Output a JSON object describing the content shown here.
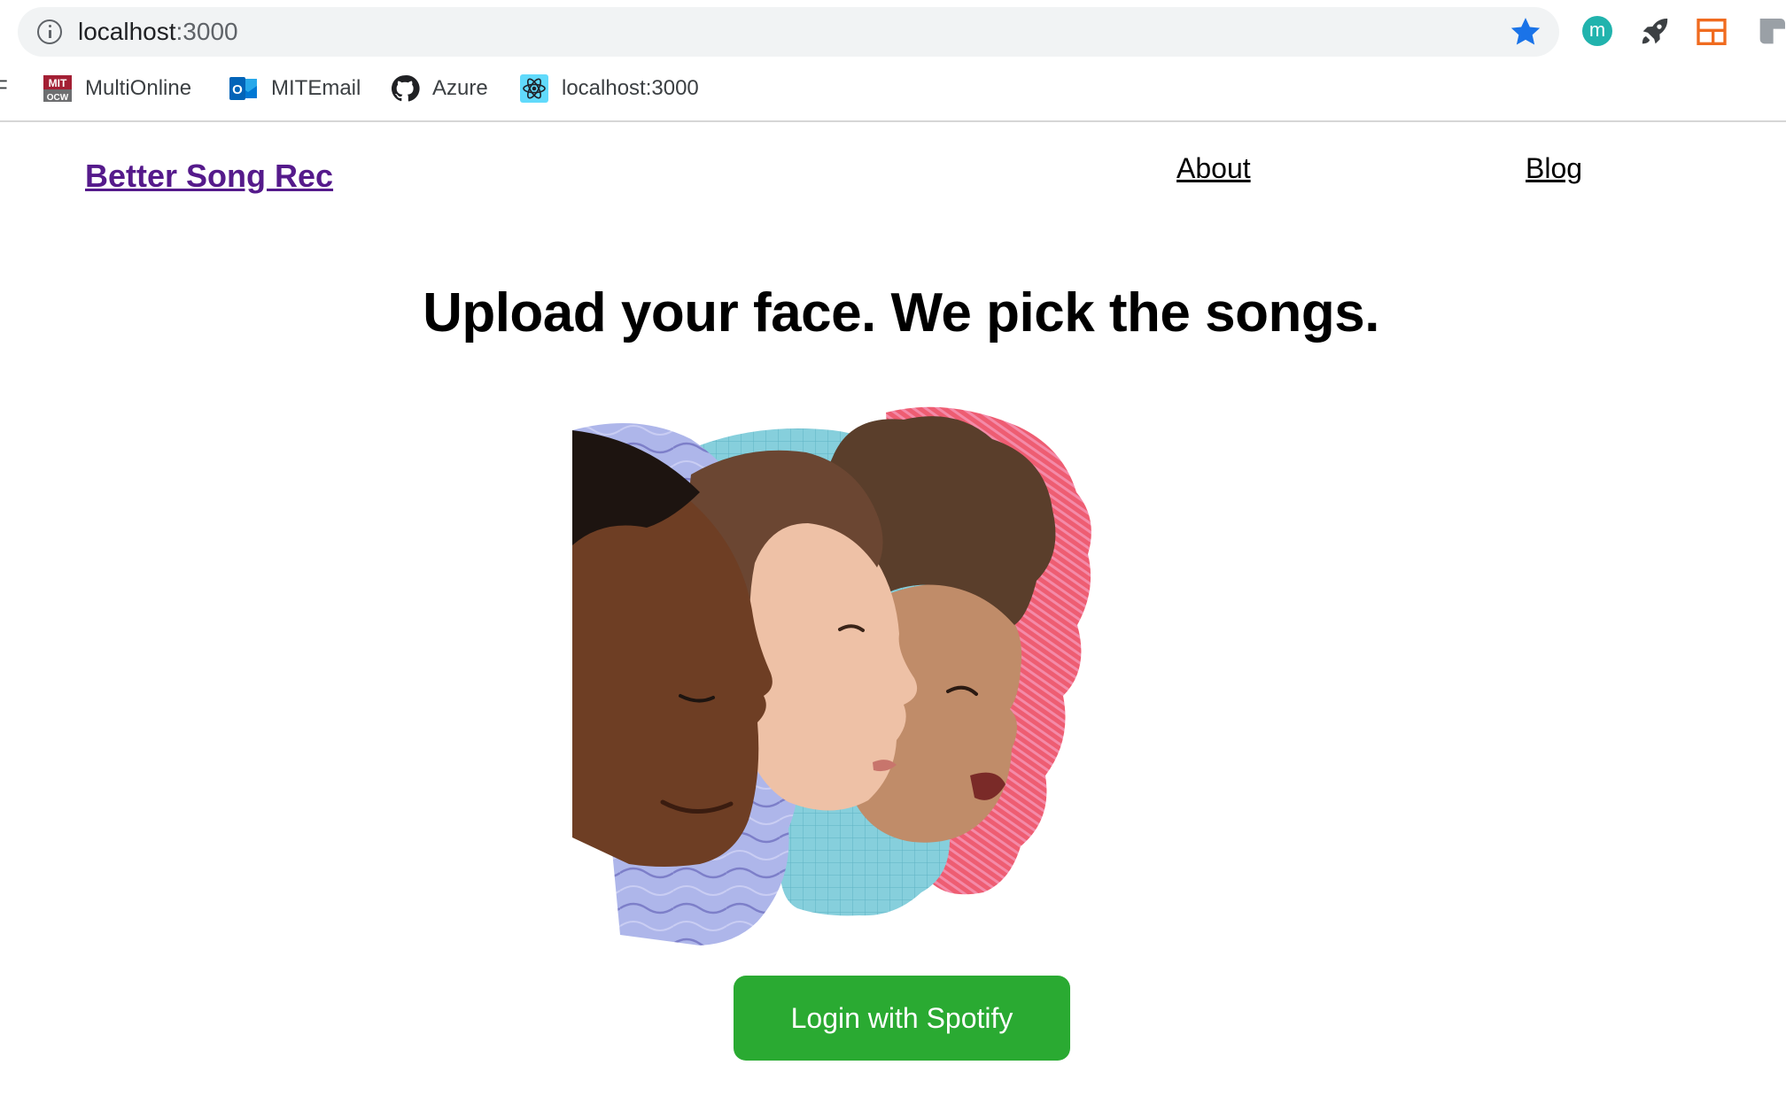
{
  "browser": {
    "url_host": "localhost",
    "url_port": ":3000",
    "extensions": {
      "m_label": "m"
    },
    "bookmarks": [
      {
        "label": "F"
      },
      {
        "label": "MultiOnline"
      },
      {
        "label": "MITEmail"
      },
      {
        "label": "Azure"
      },
      {
        "label": "localhost:3000"
      }
    ]
  },
  "site": {
    "brand": "Better Song Rec",
    "nav": {
      "about": "About",
      "blog": "Blog"
    },
    "headline": "Upload your face. We pick the songs.",
    "login_button": "Login with Spotify"
  },
  "colors": {
    "brand_link": "#551a8b",
    "spotify_green": "#2aaa32",
    "star_blue": "#1a73e8"
  }
}
